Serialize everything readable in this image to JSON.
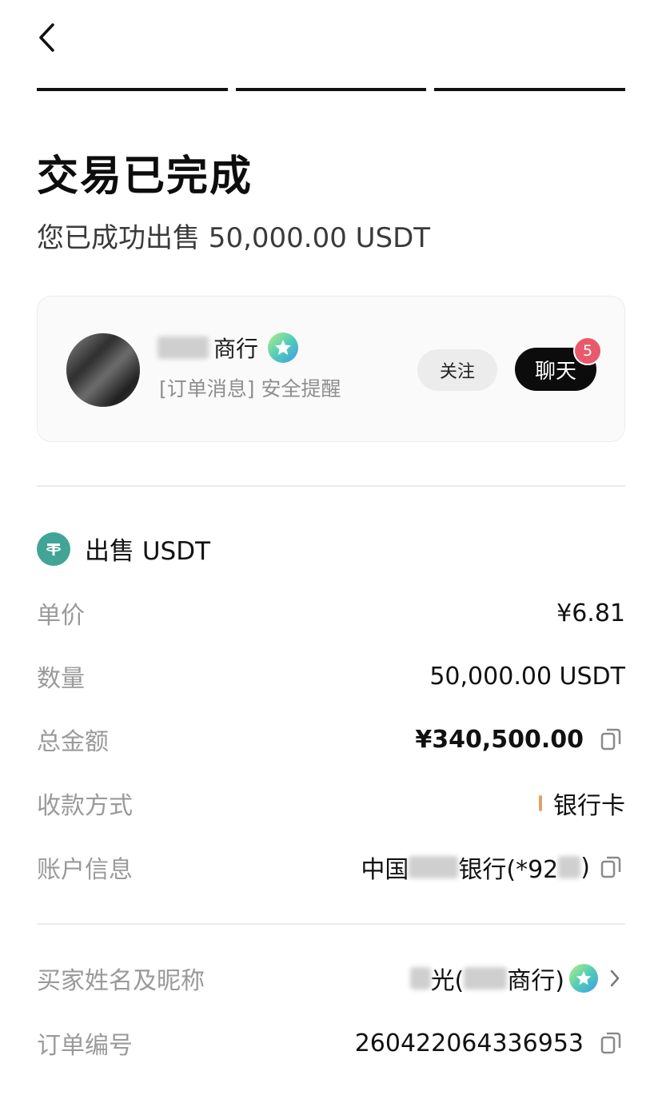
{
  "header": {
    "back_icon": "chevron-left-icon",
    "progress_steps": 3
  },
  "status": {
    "title": "交易已完成",
    "subtitle": "您已成功出售 50,000.00 USDT"
  },
  "merchant": {
    "name_visible": "商行",
    "message": "[订单消息] 安全提醒",
    "follow_label": "关注",
    "chat_label": "聊天",
    "unread_count": "5",
    "colors": {
      "chat_bg": "#0c0c0c",
      "badge": "#e85a6b",
      "verified_gradient": [
        "#b8ec80",
        "#52cdb8",
        "#3f9be6"
      ]
    }
  },
  "order": {
    "section_title": "出售 USDT",
    "token_color": "#41a496",
    "rows": [
      {
        "label": "单价",
        "value": "¥6.81"
      },
      {
        "label": "数量",
        "value": "50,000.00 USDT"
      },
      {
        "label": "总金额",
        "value": "¥340,500.00"
      },
      {
        "label": "收款方式",
        "value": "银行卡"
      },
      {
        "label": "账户信息",
        "value_prefix": "中国",
        "value_suffix": "银行(*92",
        "value_end": ")"
      }
    ]
  },
  "details": {
    "rows": [
      {
        "label": "买家姓名及昵称",
        "value_a": "光(",
        "value_b": "商行)"
      },
      {
        "label": "订单编号",
        "value": "260422064336953"
      }
    ]
  }
}
